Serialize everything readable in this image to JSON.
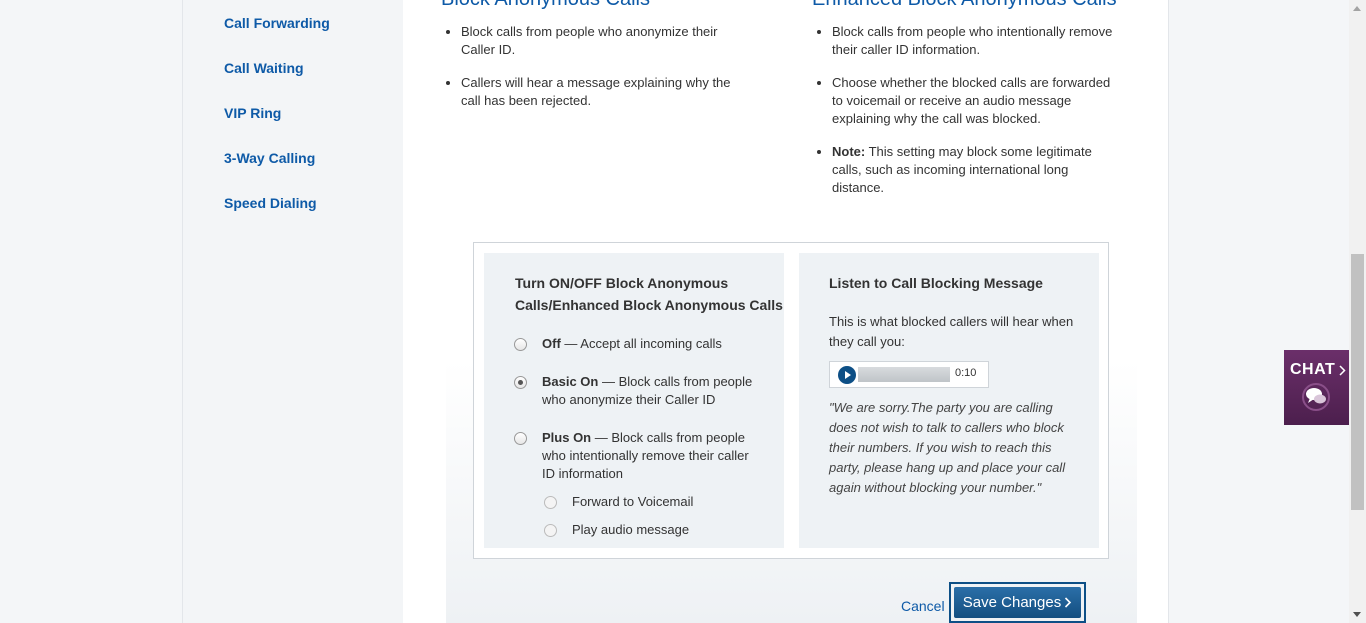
{
  "sidebar": {
    "items": [
      {
        "label": "Call Forwarding"
      },
      {
        "label": "Call Waiting"
      },
      {
        "label": "VIP Ring"
      },
      {
        "label": "3-Way Calling"
      },
      {
        "label": "Speed Dialing"
      }
    ]
  },
  "columns": {
    "left": {
      "title": "Block Anonymous Calls",
      "bullets": [
        "Block calls from people who anonymize their Caller ID.",
        "Callers will hear a message explaining why the call has been rejected."
      ]
    },
    "right": {
      "title": "Enhanced Block Anonymous Calls",
      "bullets": [
        "Block calls from people who intentionally remove their caller ID information.",
        "Choose whether the blocked calls are forwarded to voicemail or receive an audio message explaining why the call was blocked."
      ],
      "note_label": "Note:",
      "note_text": " This setting may block some legitimate calls, such as incoming international long distance."
    }
  },
  "toggle_panel": {
    "title": "Turn ON/OFF Block Anonymous Calls/Enhanced Block Anonymous Calls",
    "options": [
      {
        "label": "Off",
        "desc": " — Accept all incoming calls",
        "checked": false
      },
      {
        "label": "Basic On",
        "desc": " — Block calls from people who anonymize their Caller ID",
        "checked": true
      },
      {
        "label": "Plus On",
        "desc": " — Block calls from people who intentionally remove their caller ID information",
        "checked": false
      }
    ],
    "sub_options": [
      {
        "label": "Forward to Voicemail",
        "checked": false
      },
      {
        "label": "Play audio message",
        "checked": false
      }
    ]
  },
  "message_panel": {
    "title": "Listen to Call Blocking Message",
    "intro": "This is what blocked callers will hear when they call you:",
    "player_time": "0:10",
    "quote": "\"We are sorry.The party you are calling does not wish to talk to callers who block their numbers. If you wish to reach this party, please hang up and place your call again without blocking your number.\""
  },
  "actions": {
    "cancel_label": "Cancel",
    "save_label": "Save Changes",
    "save_icon": "chevron-right-icon"
  },
  "chat": {
    "label": "CHAT",
    "icon": "chat-bubbles-icon",
    "color": "#5a255a"
  },
  "colors": {
    "link": "#0e5aa7",
    "button": "#134e80"
  }
}
